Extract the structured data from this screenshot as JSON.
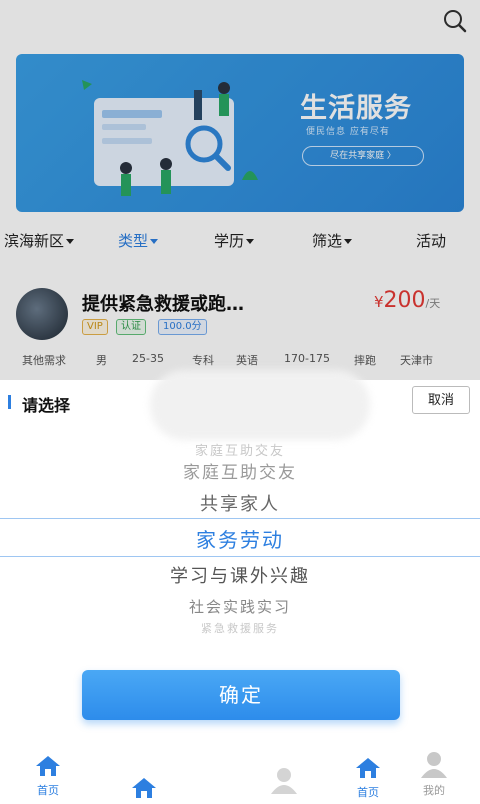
{
  "banner": {
    "title": "生活服务",
    "subtitle": "便民信息 应有尽有",
    "button_label": "尽在共享家庭 〉"
  },
  "filters": [
    {
      "label": "滨海新区",
      "active": false
    },
    {
      "label": "类型",
      "active": true
    },
    {
      "label": "学历",
      "active": false
    },
    {
      "label": "筛选",
      "active": false
    },
    {
      "label": "活动",
      "active": false
    }
  ],
  "listing": {
    "title": "提供紧急救援或跑…",
    "price_symbol": "¥",
    "price_value": "200",
    "price_unit": "/天",
    "tags": [
      "VIP",
      "认证",
      "100.0分"
    ],
    "attributes": [
      "其他需求",
      "男",
      "25-35",
      "专科",
      "英语",
      "170-175",
      "摔跑",
      "天津市"
    ]
  },
  "picker": {
    "title": "请选择",
    "cancel_label": "取消",
    "options": [
      "家庭互助交友",
      "家庭互助交友",
      "共享家人",
      "家务劳动",
      "学习与课外兴趣",
      "社会实践实习",
      "紧急救援服务"
    ],
    "selected_index": 3,
    "confirm_label": "确定"
  },
  "tabbar": {
    "items": [
      {
        "label": "首页",
        "icon": "home-icon",
        "active": true
      },
      {
        "label": "",
        "icon": "home-icon",
        "active": true
      },
      {
        "label": "",
        "icon": "user-icon",
        "active": false
      },
      {
        "label": "首页",
        "icon": "home-icon",
        "active": true
      },
      {
        "label": "我的",
        "icon": "user-icon",
        "active": false
      }
    ]
  },
  "colors": {
    "accent": "#2d7fe0",
    "price": "#e53935",
    "banner": "#3aa0e6"
  }
}
